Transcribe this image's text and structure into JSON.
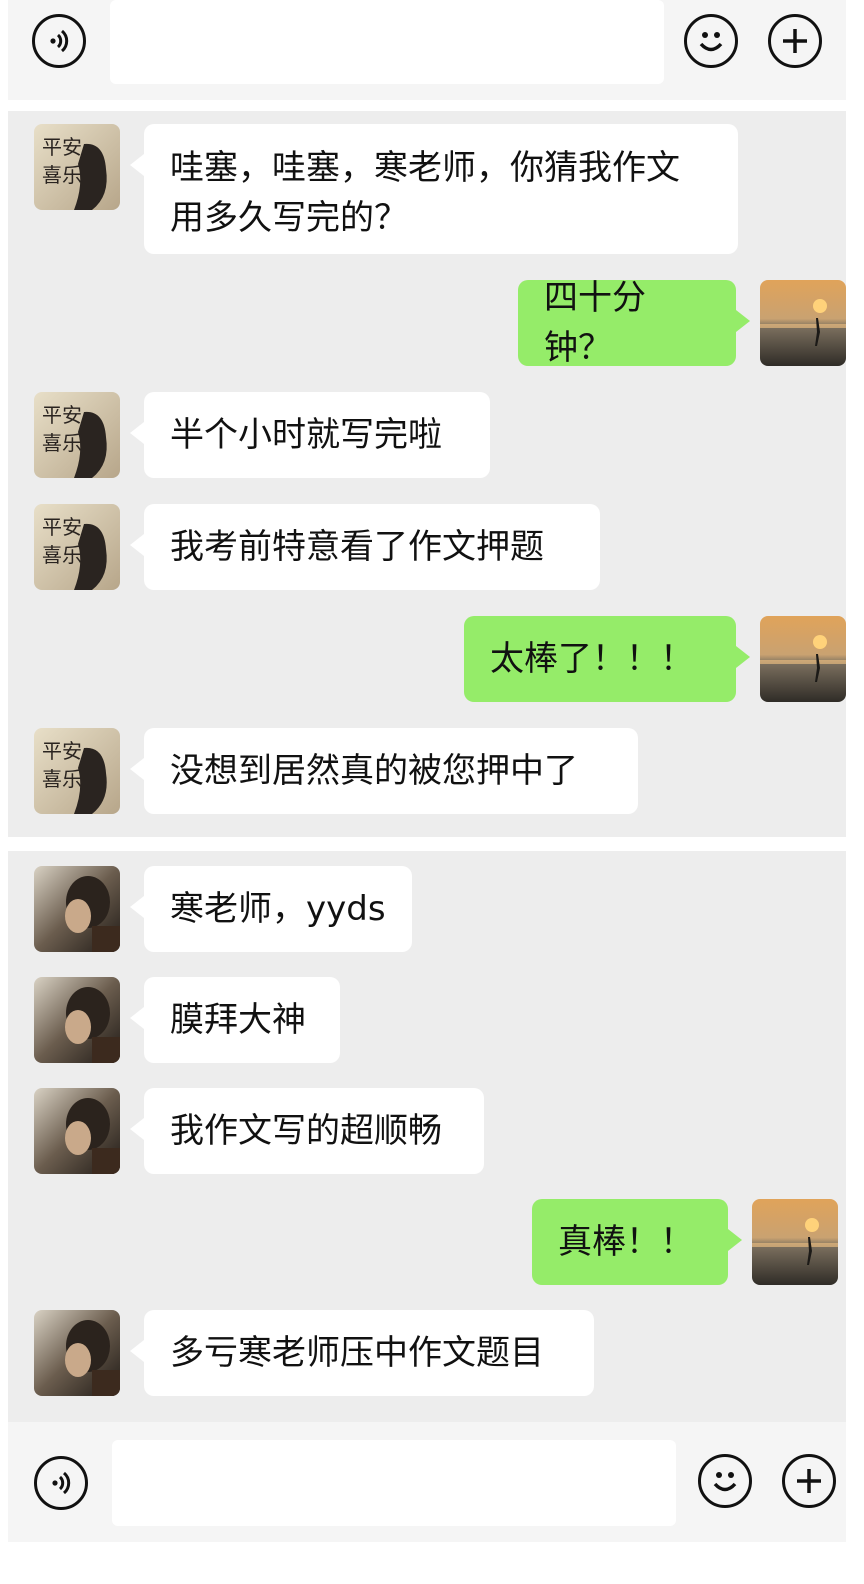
{
  "input_bar": {
    "voice_icon": "voice-icon",
    "emoji_icon": "emoji-icon",
    "plus_icon": "plus-icon",
    "text_value": ""
  },
  "chat1": {
    "messages": [
      {
        "side": "in",
        "avatar": "avatar-calligraphy",
        "text": "哇塞，哇塞，寒老师，你猜我作文\n用多久写完的？"
      },
      {
        "side": "out",
        "avatar": "avatar-sunset",
        "text": "四十分钟？"
      },
      {
        "side": "in",
        "avatar": "avatar-calligraphy",
        "text": "半个小时就写完啦"
      },
      {
        "side": "in",
        "avatar": "avatar-calligraphy",
        "text": "我考前特意看了作文押题"
      },
      {
        "side": "out",
        "avatar": "avatar-sunset",
        "text": "太棒了！！！"
      },
      {
        "side": "in",
        "avatar": "avatar-calligraphy",
        "text": "没想到居然真的被您押中了"
      }
    ]
  },
  "chat2": {
    "messages": [
      {
        "side": "in",
        "avatar": "avatar-portrait",
        "text": "寒老师，yyds"
      },
      {
        "side": "in",
        "avatar": "avatar-portrait",
        "text": "膜拜大神"
      },
      {
        "side": "in",
        "avatar": "avatar-portrait",
        "text": "我作文写的超顺畅"
      },
      {
        "side": "out",
        "avatar": "avatar-sunset",
        "text": "真棒！！"
      },
      {
        "side": "in",
        "avatar": "avatar-portrait",
        "text": "多亏寒老师压中作文题目"
      }
    ]
  }
}
